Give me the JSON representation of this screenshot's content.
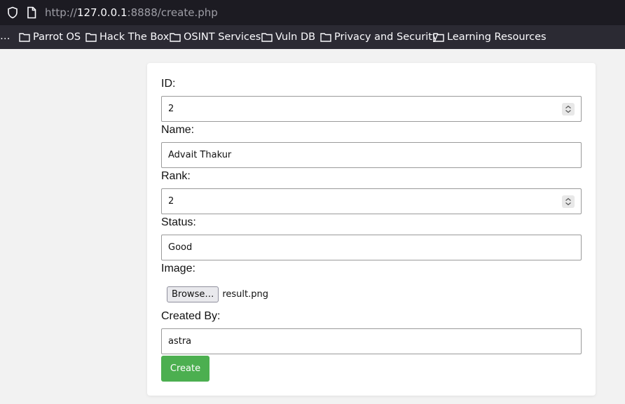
{
  "browser": {
    "url_prefix": "http://",
    "url_host": "127.0.0.1",
    "url_rest": ":8888/create.php",
    "bookmarks_overflow": "…",
    "bookmarks": [
      "Parrot OS",
      "Hack The Box",
      "OSINT Services",
      "Vuln DB",
      "Privacy and Security",
      "Learning Resources"
    ]
  },
  "form": {
    "id_label": "ID:",
    "id_value": "2",
    "name_label": "Name:",
    "name_value": "Advait Thakur",
    "rank_label": "Rank:",
    "rank_value": "2",
    "status_label": "Status:",
    "status_value": "Good",
    "image_label": "Image:",
    "browse_label": "Browse…",
    "file_name": "result.png",
    "created_by_label": "Created By:",
    "created_by_value": "astra",
    "submit_label": "Create"
  },
  "colors": {
    "submit_bg": "#4caf50",
    "urlbar_bg": "#1c1b22",
    "bookmarks_bg": "#2b2a33"
  }
}
